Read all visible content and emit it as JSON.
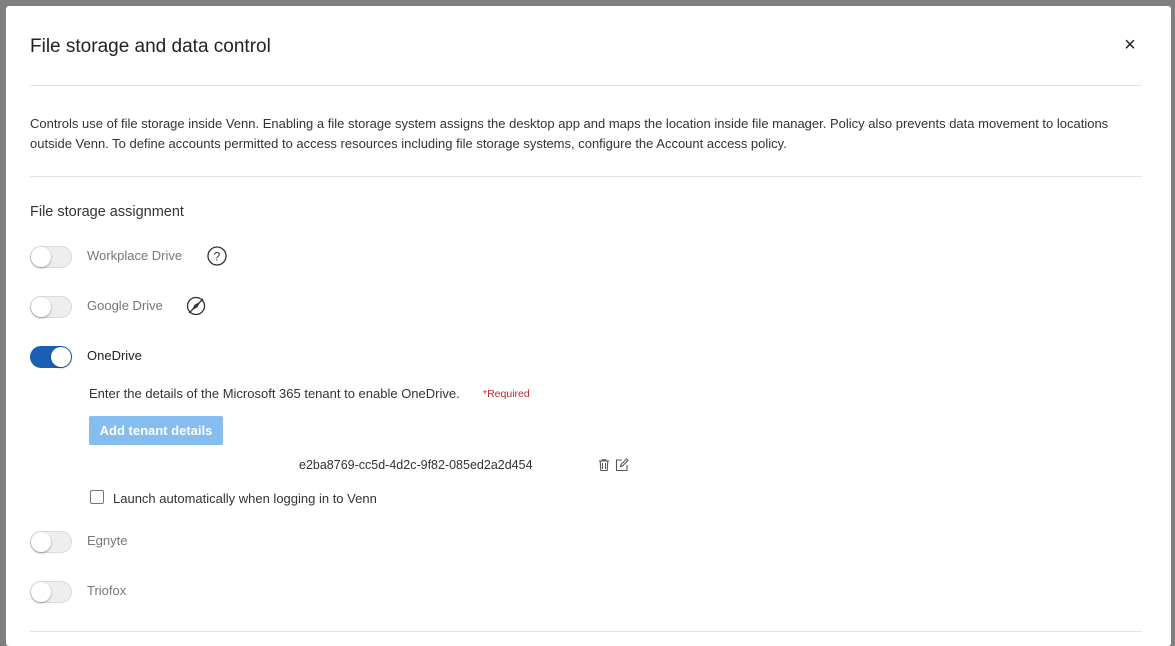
{
  "dialog": {
    "title": "File storage and data control",
    "close_label": "×",
    "description": "Controls use of file storage inside Venn. Enabling a file storage system assigns the desktop app and maps the location inside file manager. Policy also prevents data movement to locations outside Venn. To define accounts permitted to access resources including file storage systems, configure the Account access policy."
  },
  "section": {
    "title": "File storage assignment"
  },
  "storages": [
    {
      "label": "Workplace Drive",
      "enabled": false,
      "icon": "question-circle-icon"
    },
    {
      "label": "Google Drive",
      "enabled": false,
      "icon": "compass-slash-icon"
    },
    {
      "label": "OneDrive",
      "enabled": true
    },
    {
      "label": "Egnyte",
      "enabled": false
    },
    {
      "label": "Triofox",
      "enabled": false
    }
  ],
  "onedrive": {
    "tenant_message": "Enter the details of the Microsoft 365 tenant to enable OneDrive.",
    "required_label": "*Required",
    "add_button_label": "Add tenant details",
    "tenant_id": "e2ba8769-cc5d-4d2c-9f82-085ed2a2d454",
    "launch_label": "Launch automatically when logging in to Venn",
    "launch_checked": false
  },
  "colors": {
    "toggle_on": "#1a5fb4",
    "button": "#86bdf0",
    "required": "#c62828"
  }
}
